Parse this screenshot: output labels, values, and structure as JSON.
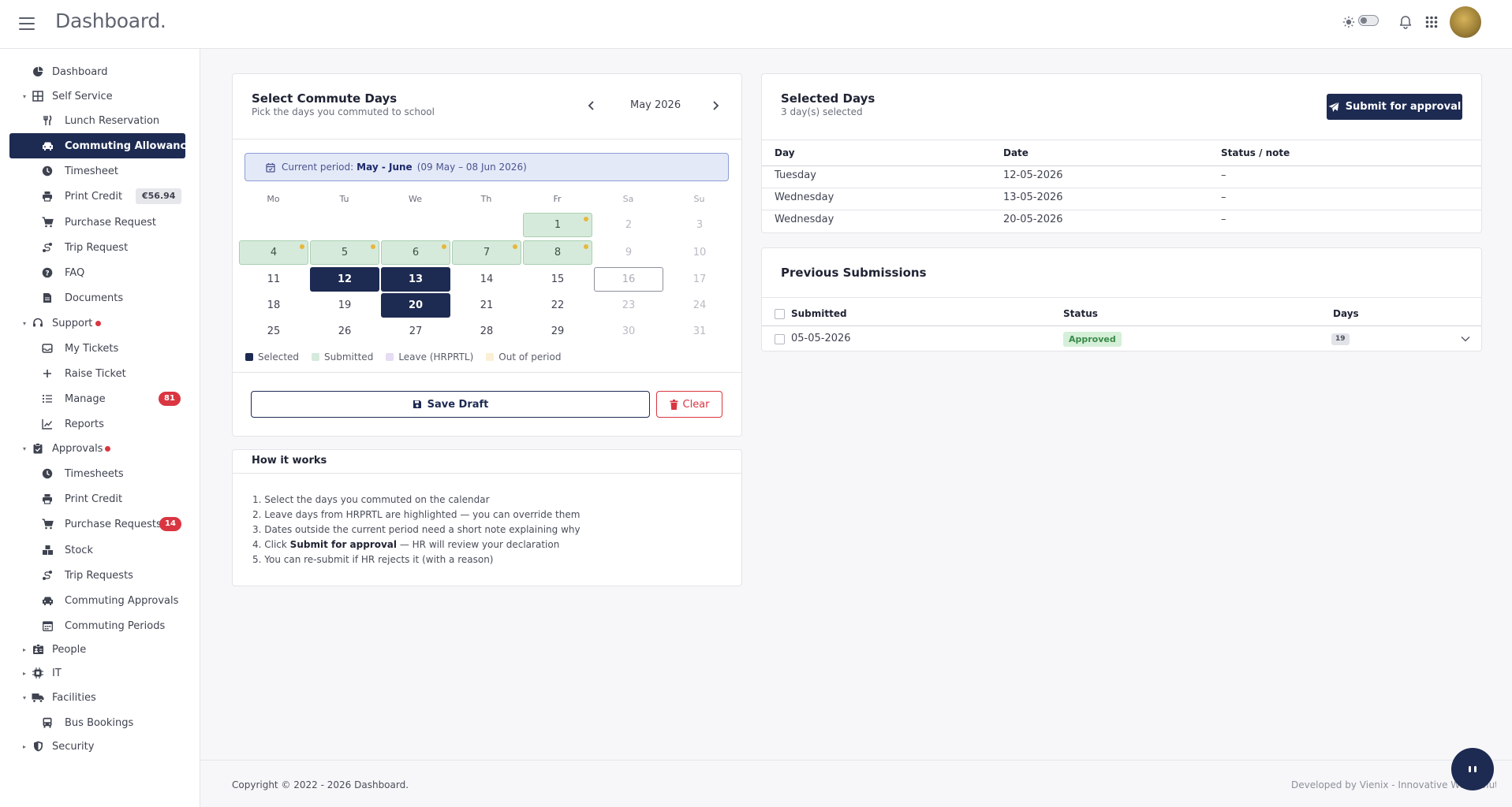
{
  "header": {
    "brand": "Dashboard.",
    "icons": [
      "menu-icon",
      "sun-icon",
      "theme-toggle",
      "bell-icon",
      "apps-grid-icon",
      "avatar"
    ]
  },
  "sidebar": {
    "items": [
      {
        "label": "Dashboard",
        "icon": "dashboard-icon"
      },
      {
        "label": "Self Service",
        "icon": "grid-icon",
        "expanded": true
      },
      {
        "label": "Lunch Reservation",
        "icon": "cutlery-icon"
      },
      {
        "label": "Commuting Allowance",
        "icon": "car-icon",
        "active": true
      },
      {
        "label": "Timesheet",
        "icon": "clock-icon"
      },
      {
        "label": "Print Credit",
        "icon": "printer-icon",
        "badge": "€56.94"
      },
      {
        "label": "Purchase Request",
        "icon": "cart-icon"
      },
      {
        "label": "Trip Request",
        "icon": "route-icon"
      },
      {
        "label": "FAQ",
        "icon": "question-icon"
      },
      {
        "label": "Documents",
        "icon": "document-icon"
      },
      {
        "label": "Support",
        "icon": "headset-icon",
        "expanded": true
      },
      {
        "label": "My Tickets",
        "icon": "inbox-icon"
      },
      {
        "label": "Raise Ticket",
        "icon": "plus-icon"
      },
      {
        "label": "Manage",
        "icon": "list-icon",
        "badge": "81"
      },
      {
        "label": "Reports",
        "icon": "chart-icon"
      },
      {
        "label": "Approvals",
        "icon": "clipboard-icon",
        "expanded": true
      },
      {
        "label": "Timesheets",
        "icon": "clock-icon"
      },
      {
        "label": "Print Credit",
        "icon": "printer-icon"
      },
      {
        "label": "Purchase Requests",
        "icon": "cart-icon",
        "badge": "14"
      },
      {
        "label": "Stock",
        "icon": "boxes-icon"
      },
      {
        "label": "Trip Requests",
        "icon": "route-icon"
      },
      {
        "label": "Commuting Approvals",
        "icon": "car-icon"
      },
      {
        "label": "Commuting Periods",
        "icon": "calendar-icon"
      },
      {
        "label": "People",
        "icon": "id-card-icon"
      },
      {
        "label": "IT",
        "icon": "cpu-icon"
      },
      {
        "label": "Facilities",
        "icon": "truck-icon",
        "expanded": true
      },
      {
        "label": "Bus Bookings",
        "icon": "bus-icon"
      },
      {
        "label": "Security",
        "icon": "shield-icon"
      }
    ]
  },
  "calendar_card": {
    "title": "Select Commute Days",
    "subtitle": "Pick the days you commuted to school",
    "month": "May 2026",
    "period_prefix": "Current period:",
    "period_name": "May - June",
    "period_range": "(09 May – 08 Jun 2026)",
    "weekdays": [
      "Mo",
      "Tu",
      "We",
      "Th",
      "Fr",
      "Sa",
      "Su"
    ],
    "weeks": [
      [
        "",
        "",
        "",
        "",
        "1",
        "2",
        "3"
      ],
      [
        "4",
        "5",
        "6",
        "7",
        "8",
        "9",
        "10"
      ],
      [
        "11",
        "12",
        "13",
        "14",
        "15",
        "16",
        "17"
      ],
      [
        "18",
        "19",
        "20",
        "21",
        "22",
        "23",
        "24"
      ],
      [
        "25",
        "26",
        "27",
        "28",
        "29",
        "30",
        "31"
      ]
    ],
    "selected_days": [
      "12",
      "13",
      "20"
    ],
    "submitted_days": [
      "1",
      "4",
      "5",
      "6",
      "7",
      "8"
    ],
    "legend": [
      "Selected",
      "Submitted",
      "Leave (HRPRTL)",
      "Out of period"
    ],
    "save_label": "Save Draft",
    "clear_label": "Clear"
  },
  "howto": {
    "title": "How it works",
    "items": [
      "1. Select the days you commuted on the calendar",
      "2. Leave days from HRPRTL are highlighted — you can override them",
      "3. Dates outside the current period need a short note explaining why",
      "4. Click ",
      "5. You can re-submit if HR rejects it (with a reason)"
    ],
    "item4_bold": "Submit for approval",
    "item4_rest": " — HR will review your declaration"
  },
  "selected_days_card": {
    "title": "Selected Days",
    "subtitle": "3 day(s) selected",
    "submit_label": "Submit for approval",
    "columns": [
      "Day",
      "Date",
      "Status / note"
    ],
    "rows": [
      [
        "Tuesday",
        "12-05-2026",
        "–"
      ],
      [
        "Wednesday",
        "13-05-2026",
        "–"
      ],
      [
        "Wednesday",
        "20-05-2026",
        "–"
      ]
    ]
  },
  "previous_submissions": {
    "title": "Previous Submissions",
    "columns": [
      "Submitted",
      "Status",
      "Days"
    ],
    "rows": [
      {
        "submitted": "05-05-2026",
        "status": "Approved",
        "days": "19"
      }
    ]
  },
  "footer": {
    "copyright": "Copyright © 2022 - 2026 Dashboard.",
    "developer": "Developed by Vienix - Innovative Web Solutions"
  },
  "colors": {
    "primary": "#1d2a52",
    "danger": "#d93641",
    "submitted": "#d6eadb",
    "leave": "#e6dcf3",
    "out_of_period": "#fbefd5",
    "approved": "#3a8a48"
  }
}
